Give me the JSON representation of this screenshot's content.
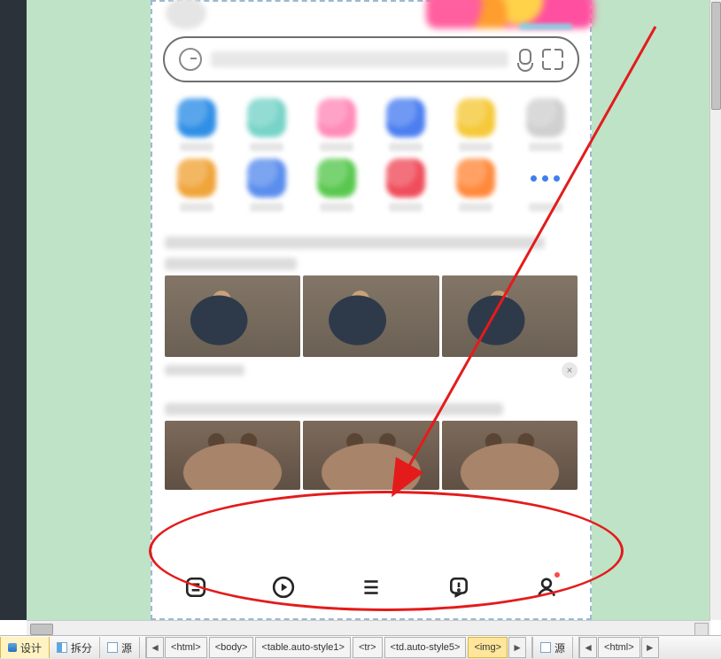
{
  "status": {
    "tabs": {
      "design": "设计",
      "split": "拆分",
      "source": "源"
    },
    "breadcrumb": [
      "<html>",
      "<body>",
      "<table.auto-style1>",
      "<tr>",
      "<td.auto-style5>",
      "<img>"
    ],
    "source_right": "源",
    "right_crumb": "<html>",
    "nav_left": "◄",
    "nav_right": "►"
  },
  "apps": {
    "row1_colors": [
      "#2f8fe6",
      "#78d3c8",
      "#ff8bb9",
      "#4b7ff0",
      "#f5c93a",
      "#d0d0d0"
    ],
    "row2_colors": [
      "#f0a43a",
      "#5a8ded",
      "#59c84f",
      "#ef4d5b",
      "#ff8a3d",
      "more"
    ]
  },
  "icons": {
    "search": "g-search-icon",
    "mic": "mic-icon",
    "scan": "scan-icon",
    "tab_feed": "feed-icon",
    "tab_play": "play-icon",
    "tab_menu": "menu-icon",
    "tab_alert": "alert-icon",
    "tab_profile": "profile-icon"
  },
  "annotations": {
    "ellipse": "highlight-bottom-tabbar",
    "arrow": "arrow-to-tabbar"
  }
}
